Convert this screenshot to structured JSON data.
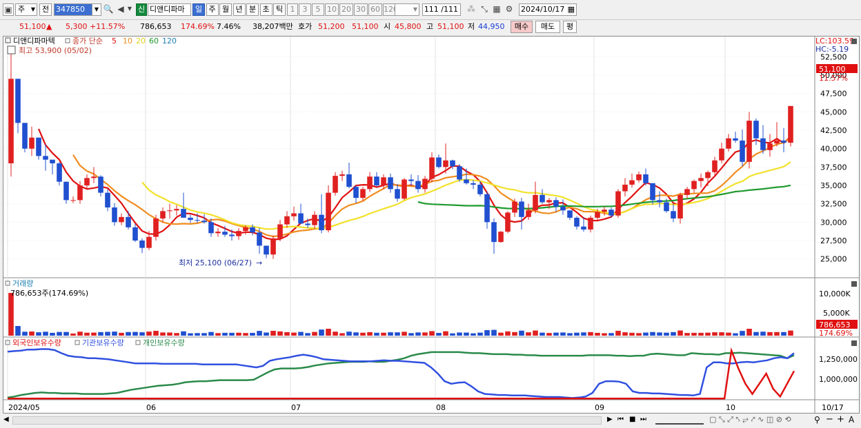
{
  "toolbar": {
    "market_select": "주",
    "prev_label": "전",
    "stock_code": "347850",
    "stock_name": "디앤디파마",
    "new_badge": "신",
    "periods": [
      "일",
      "주",
      "월",
      "년",
      "분",
      "초",
      "틱"
    ],
    "period_selected": "일",
    "intervals": [
      "1",
      "3",
      "5",
      "10",
      "20",
      "30",
      "60",
      "120"
    ],
    "count_display": "111 /111",
    "date": "2024/10/17"
  },
  "info": {
    "price": "51,100",
    "change_arrow": "▲",
    "change": "5,300",
    "change_pct": "+11.57%",
    "volume": "786,653",
    "volume_ratio": "174.69%",
    "turnover": "7.46%",
    "amount": "38,207백만",
    "bid_label": "호가",
    "bid1": "51,200",
    "bid2": "51,100",
    "open_label": "시",
    "open": "45,800",
    "high_label": "고",
    "high": "51,100",
    "low_label": "저",
    "low": "44,950",
    "buy_label": "매수",
    "sell_label": "매도",
    "avg_label": "평"
  },
  "chart_data": {
    "type": "candlestick",
    "price_panel": {
      "stock_label": "디앤디파마텍",
      "ma_label": "종가 단순",
      "ma_periods": [
        "5",
        "10",
        "20",
        "60",
        "120"
      ],
      "high_note": "최고 53,900 (05/02)",
      "low_note": "최저 25,100 (06/27)",
      "lc": "LC:103.59",
      "hc": "HC:-5.19",
      "current_price_tag": "51,100",
      "current_pct_tag": "11.57%",
      "yticks": [
        52500,
        50000,
        47500,
        45000,
        42500,
        40000,
        37500,
        35000,
        32500,
        30000,
        27500,
        25000
      ],
      "ylim": [
        23000,
        54500
      ],
      "colors": {
        "up": "#e02020",
        "down": "#2050d0",
        "ma5": "#e01010",
        "ma10": "#f08c1e",
        "ma20": "#f2e12a",
        "ma60": "#1f9a2e"
      }
    },
    "candles": [
      [
        38000,
        53900,
        36200,
        49500
      ],
      [
        49500,
        46500,
        42100,
        43500
      ],
      [
        43500,
        42800,
        39500,
        40000
      ],
      [
        40000,
        43000,
        39000,
        41500
      ],
      [
        41500,
        41500,
        38500,
        39000
      ],
      [
        39000,
        40600,
        37000,
        38500
      ],
      [
        38500,
        38200,
        36500,
        38000
      ],
      [
        38000,
        38200,
        35000,
        35500
      ],
      [
        35500,
        35000,
        32500,
        33000
      ],
      [
        33000,
        33500,
        32600,
        33000
      ],
      [
        33000,
        35600,
        32500,
        35000
      ],
      [
        35000,
        36500,
        34500,
        36000
      ],
      [
        36000,
        37500,
        35300,
        36200
      ],
      [
        36200,
        36400,
        33500,
        34000
      ],
      [
        34000,
        34500,
        31500,
        32000
      ],
      [
        32000,
        32600,
        29500,
        30000
      ],
      [
        30000,
        31200,
        29600,
        30700
      ],
      [
        30700,
        31500,
        29000,
        29300
      ],
      [
        29300,
        29800,
        27300,
        27500
      ],
      [
        27500,
        27800,
        25800,
        26500
      ],
      [
        26500,
        28800,
        26200,
        28000
      ],
      [
        28000,
        31000,
        27500,
        30500
      ],
      [
        30500,
        32000,
        30000,
        31500
      ],
      [
        31500,
        32500,
        30500,
        31600
      ],
      [
        31600,
        32300,
        30900,
        31800
      ],
      [
        31800,
        34000,
        30800,
        30600
      ],
      [
        30600,
        31000,
        29900,
        30300
      ],
      [
        30300,
        31200,
        29900,
        30200
      ],
      [
        30200,
        31100,
        29800,
        30000
      ],
      [
        30000,
        30500,
        28000,
        28500
      ],
      [
        28500,
        29200,
        28000,
        28700
      ],
      [
        28700,
        29500,
        28000,
        28300
      ],
      [
        28300,
        29000,
        27500,
        28100
      ],
      [
        28100,
        29200,
        27600,
        28800
      ],
      [
        28800,
        29600,
        28300,
        29300
      ],
      [
        29300,
        29700,
        28200,
        28600
      ],
      [
        28600,
        29200,
        25700,
        26800
      ],
      [
        26800,
        26500,
        25100,
        25600
      ],
      [
        25600,
        28200,
        25000,
        27800
      ],
      [
        27800,
        30300,
        27400,
        29700
      ],
      [
        29700,
        31500,
        29200,
        30800
      ],
      [
        30800,
        32100,
        30200,
        31200
      ],
      [
        31200,
        32500,
        30400,
        29800
      ],
      [
        29800,
        30500,
        29200,
        29600
      ],
      [
        29600,
        31500,
        29000,
        31000
      ],
      [
        31000,
        33800,
        28500,
        28900
      ],
      [
        28900,
        35000,
        28600,
        34000
      ],
      [
        34000,
        36800,
        33600,
        36300
      ],
      [
        36300,
        37000,
        35600,
        36500
      ],
      [
        36500,
        38100,
        34600,
        34800
      ],
      [
        34800,
        35000,
        32600,
        33300
      ],
      [
        33300,
        34800,
        32900,
        34500
      ],
      [
        34500,
        36800,
        34100,
        36200
      ],
      [
        36200,
        36800,
        34800,
        35000
      ],
      [
        35000,
        36500,
        34500,
        36100
      ],
      [
        36100,
        36600,
        34000,
        34500
      ],
      [
        34500,
        35200,
        32800,
        33200
      ],
      [
        33200,
        36000,
        33000,
        35800
      ],
      [
        35800,
        36500,
        35000,
        35600
      ],
      [
        35600,
        36400,
        34000,
        34500
      ],
      [
        34500,
        36300,
        34000,
        35900
      ],
      [
        35900,
        39500,
        35400,
        38800
      ],
      [
        38800,
        39200,
        37300,
        37500
      ],
      [
        37500,
        40700,
        36600,
        38400
      ],
      [
        38400,
        38500,
        37200,
        37600
      ],
      [
        37600,
        37900,
        35500,
        35800
      ],
      [
        35800,
        37300,
        35100,
        35300
      ],
      [
        35300,
        35700,
        34500,
        35100
      ],
      [
        35100,
        35600,
        33500,
        33800
      ],
      [
        33800,
        34200,
        29100,
        30000
      ],
      [
        30000,
        30500,
        25700,
        27300
      ],
      [
        27300,
        28800,
        27200,
        28700
      ],
      [
        28700,
        31500,
        28500,
        31300
      ],
      [
        31300,
        33200,
        30700,
        32800
      ],
      [
        32800,
        33300,
        29000,
        30700
      ],
      [
        30700,
        32500,
        30300,
        31600
      ],
      [
        31600,
        35500,
        31200,
        33700
      ],
      [
        33700,
        34500,
        32500,
        32700
      ],
      [
        32700,
        33300,
        31800,
        33000
      ],
      [
        33000,
        33400,
        31400,
        32100
      ],
      [
        32100,
        33100,
        31000,
        31600
      ],
      [
        31600,
        31600,
        30300,
        30600
      ],
      [
        30600,
        30800,
        29000,
        29400
      ],
      [
        29400,
        30700,
        28700,
        29000
      ],
      [
        29000,
        30900,
        28600,
        30600
      ],
      [
        30600,
        31800,
        30200,
        31400
      ],
      [
        31400,
        32100,
        30900,
        31700
      ],
      [
        31700,
        32000,
        30600,
        30900
      ],
      [
        30900,
        34500,
        30600,
        34200
      ],
      [
        34200,
        36000,
        33500,
        35100
      ],
      [
        35100,
        36600,
        34700,
        35700
      ],
      [
        35700,
        36900,
        35400,
        36500
      ],
      [
        36500,
        37300,
        35000,
        35300
      ],
      [
        35300,
        34500,
        32400,
        33000
      ],
      [
        33000,
        34200,
        32000,
        32700
      ],
      [
        32700,
        33200,
        31300,
        31500
      ],
      [
        31500,
        32500,
        30000,
        30500
      ],
      [
        30500,
        34000,
        29800,
        33700
      ],
      [
        33700,
        34800,
        33200,
        34500
      ],
      [
        34500,
        35800,
        34000,
        35600
      ],
      [
        35600,
        36600,
        34700,
        36000
      ],
      [
        36000,
        37000,
        34900,
        36800
      ],
      [
        36800,
        38900,
        36200,
        38400
      ],
      [
        38400,
        40800,
        38000,
        40000
      ],
      [
        40000,
        42000,
        39600,
        41400
      ],
      [
        41400,
        42300,
        40800,
        41100
      ],
      [
        41100,
        42600,
        37600,
        38200
      ],
      [
        38200,
        45000,
        37300,
        43800
      ],
      [
        43800,
        44100,
        40500,
        41400
      ],
      [
        41400,
        43200,
        39300,
        39800
      ],
      [
        39800,
        42000,
        38900,
        40700
      ],
      [
        40700,
        43600,
        40300,
        41100
      ],
      [
        41100,
        42800,
        39500,
        40800
      ],
      [
        40800,
        45800,
        40300,
        45800
      ]
    ],
    "volume_panel": {
      "title": "거래량",
      "readout": "786,653주(174.69%)",
      "yticks": [
        "10,000K",
        "5,000K"
      ],
      "current_tag": "786,653",
      "current_pct": "174.69%"
    },
    "holdings_panel": {
      "series_names": [
        "외국인보유수량",
        "기관보유수량",
        "개인보유수량"
      ],
      "yticks": [
        "1,250,000",
        "1,000,000"
      ],
      "colors": {
        "foreign": "#e01010",
        "institution": "#3050e0",
        "individual": "#2a8a4a"
      }
    },
    "x_labels": [
      "2024/05",
      "06",
      "07",
      "08",
      "09",
      "10"
    ],
    "last_date_label": "10/17"
  }
}
